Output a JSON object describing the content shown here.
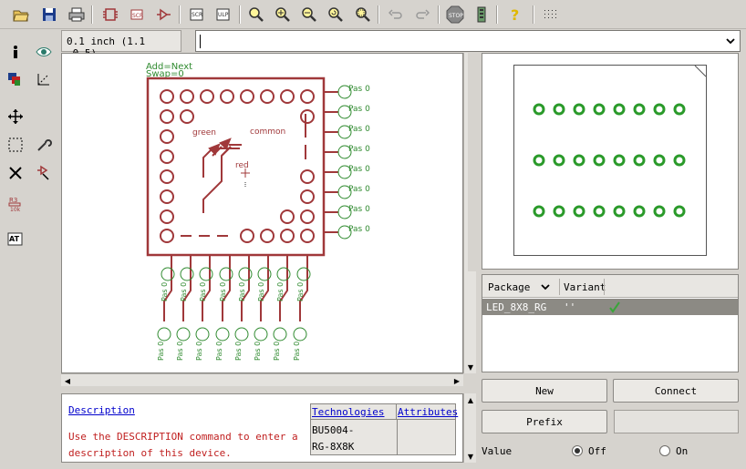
{
  "coord_display": "0.1 inch (1.1 -0.5)",
  "command_input": {
    "value": ""
  },
  "schematic": {
    "add_label": "Add=Next",
    "swap_label": "Swap=0",
    "pin_labels": [
      "Pas 0",
      "Pas 0",
      "Pas 0",
      "Pas 0",
      "Pas 0",
      "Pas 0",
      "Pas 0",
      "Pas 0"
    ],
    "bottom_pin_label": "Pas 0",
    "text_green": "green",
    "text_common": "common",
    "text_red": "red",
    "colors": {
      "symbol": "#a0383a",
      "pin": "#2f8a2f",
      "pad": "#2a9a2a"
    }
  },
  "package_table": {
    "headers": [
      "Package",
      "Variant"
    ],
    "rows": [
      {
        "package": "LED_8X8_RG",
        "variant": "''"
      }
    ]
  },
  "description": {
    "title": "Description",
    "text_line1": "Use the DESCRIPTION command to enter a",
    "text_line2": "description of this device.",
    "tabs": [
      "Technologies",
      "Attributes"
    ],
    "tech_line1": "BU5004-",
    "tech_line2": "RG-8X8K"
  },
  "buttons": {
    "new": "New",
    "connect": "Connect",
    "prefix": "Prefix"
  },
  "value_field": {
    "label": "Value",
    "off_label": "Off",
    "on_label": "On",
    "selected": "Off"
  }
}
